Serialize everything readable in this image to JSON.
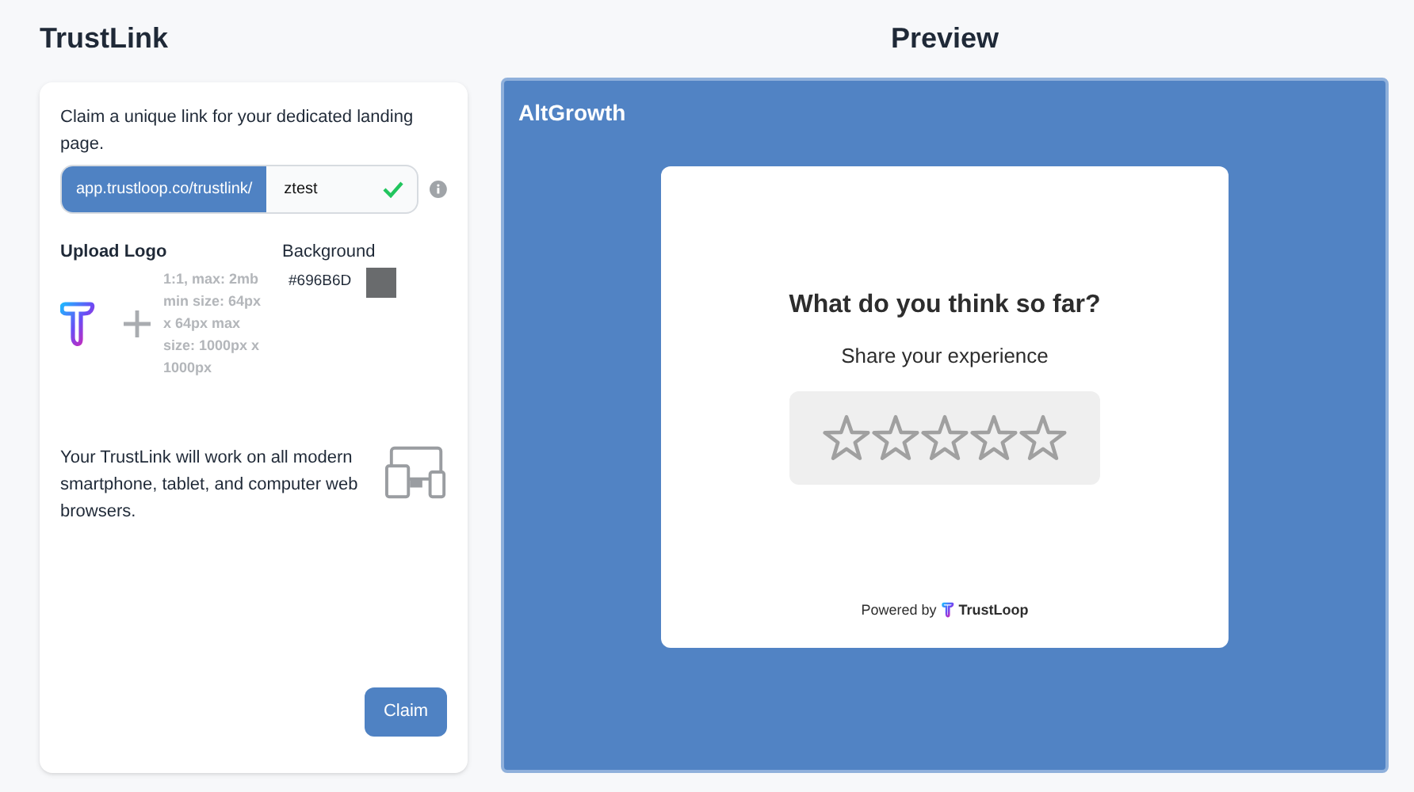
{
  "left": {
    "title": "TrustLink",
    "intro": "Claim a unique link for your dedicated landing page.",
    "link_field": {
      "prefix": "app.trustloop.co/trustlink/",
      "value": "ztest",
      "valid": true
    },
    "upload_logo": {
      "label": "Upload Logo",
      "hint": "1:1, max: 2mb min size: 64px x 64px max size: 1000px x 1000px"
    },
    "background": {
      "label": "Background",
      "value": "#696B6D"
    },
    "note": "Your TrustLink will work on all modern smartphone, tablet, and computer web browsers.",
    "claim_button": "Claim"
  },
  "preview": {
    "title": "Preview",
    "brand": "AltGrowth",
    "card": {
      "question": "What do you think so far?",
      "subtitle": "Share your experience",
      "stars": 0,
      "powered_by": "Powered by",
      "powered_brand": "TrustLoop"
    }
  }
}
